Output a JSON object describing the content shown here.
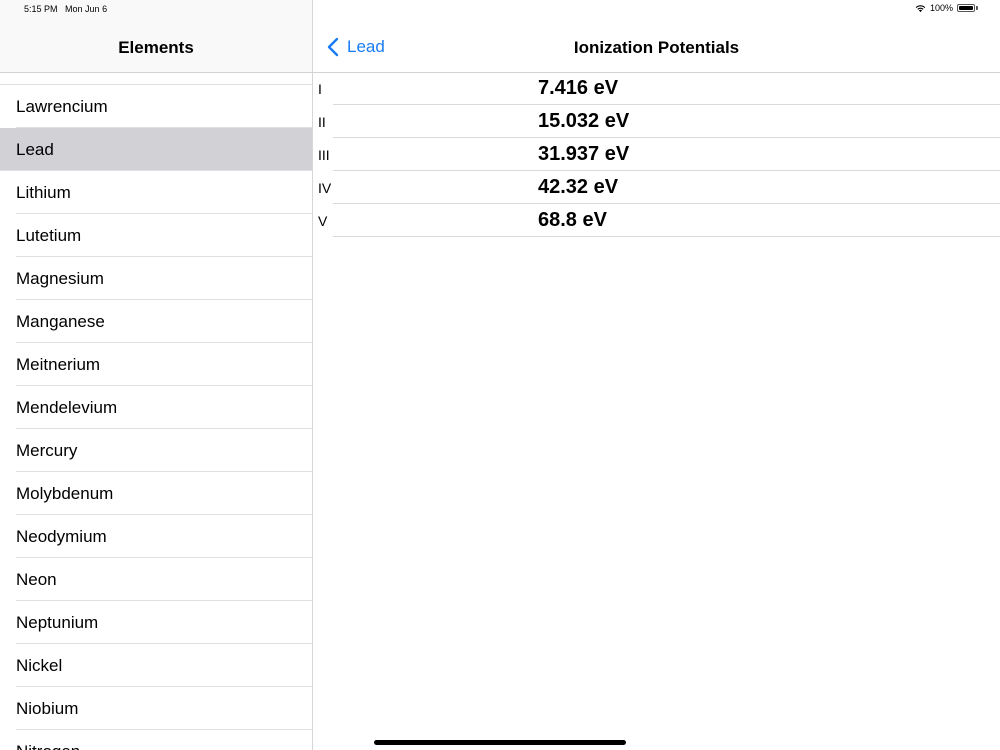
{
  "status_bar": {
    "time": "5:15 PM",
    "date": "Mon Jun 6",
    "battery": "100%",
    "icons": [
      "wifi-icon",
      "battery-icon"
    ]
  },
  "sidebar": {
    "title": "Elements",
    "items": [
      {
        "label": "Lawrencium"
      },
      {
        "label": "Lead",
        "selected": true
      },
      {
        "label": "Lithium"
      },
      {
        "label": "Lutetium"
      },
      {
        "label": "Magnesium"
      },
      {
        "label": "Manganese"
      },
      {
        "label": "Meitnerium"
      },
      {
        "label": "Mendelevium"
      },
      {
        "label": "Mercury"
      },
      {
        "label": "Molybdenum"
      },
      {
        "label": "Neodymium"
      },
      {
        "label": "Neon"
      },
      {
        "label": "Neptunium"
      },
      {
        "label": "Nickel"
      },
      {
        "label": "Niobium"
      },
      {
        "label": "Nitrogen"
      }
    ]
  },
  "detail": {
    "back_label": "Lead",
    "title": "Ionization Potentials",
    "rows": [
      {
        "label": "I",
        "value": "7.416 eV"
      },
      {
        "label": "II",
        "value": "15.032 eV"
      },
      {
        "label": "III",
        "value": "31.937 eV"
      },
      {
        "label": "IV",
        "value": "42.32 eV"
      },
      {
        "label": "V",
        "value": "68.8 eV"
      }
    ]
  },
  "colors": {
    "accent": "#1a7cf5",
    "selected_row": "#d1d1d6",
    "separator": "#e0e0e0"
  }
}
